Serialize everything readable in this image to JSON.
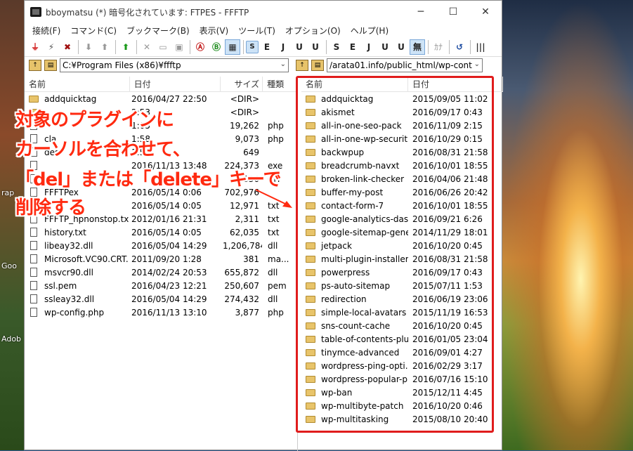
{
  "window": {
    "title": "bboymatsu (*) 暗号化されています: FTPES - FFFTP",
    "min": "─",
    "max": "☐",
    "close": "✕"
  },
  "menu": [
    "接続(F)",
    "コマンド(C)",
    "ブックマーク(B)",
    "表示(V)",
    "ツール(T)",
    "オプション(O)",
    "ヘルプ(H)"
  ],
  "toolbar": [
    "S",
    "E",
    "J",
    "U",
    "U",
    "S",
    "E",
    "J",
    "U",
    "U",
    "無",
    "ｶﾅ"
  ],
  "left_path": "C:¥Program Files (x86)¥ffftp",
  "right_path": "/arata01.info/public_html/wp-cont",
  "left_headers": {
    "name": "名前",
    "date": "日付",
    "size": "サイズ",
    "type": "種類"
  },
  "right_headers": {
    "name": "名前",
    "date": "日付"
  },
  "left_files": [
    {
      "name": "addquicktag",
      "date": "2016/04/27 22:50",
      "size": "<DIR>",
      "type": "",
      "folder": true
    },
    {
      "name": "",
      "date": "2:53",
      "size": "<DIR>",
      "type": "",
      "folder": true
    },
    {
      "name": "",
      "date": "1:05",
      "size": "19,262",
      "type": "php",
      "folder": false
    },
    {
      "name": "cla",
      "date": "1:58",
      "size": "9,073",
      "type": "php",
      "folder": false
    },
    {
      "name": "des",
      "date": "1:58",
      "size": "649",
      "type": "",
      "folder": false
    },
    {
      "name": "",
      "date": "2016/11/13 13:48",
      "size": "224,373",
      "type": "exe",
      "folder": false
    },
    {
      "name": "",
      "date": "",
      "size": "836",
      "type": "CH",
      "folder": false
    },
    {
      "name": "FFFTPex",
      "date": "2016/05/14 0:06",
      "size": "702,976",
      "type": "",
      "folder": false
    },
    {
      "name": "",
      "date": "2016/05/14 0:05",
      "size": "12,971",
      "type": "txt",
      "folder": false
    },
    {
      "name": "FFFTP_hpnonstop.txt",
      "date": "2012/01/16 21:31",
      "size": "2,311",
      "type": "txt",
      "folder": false
    },
    {
      "name": "history.txt",
      "date": "2016/05/14 0:05",
      "size": "62,035",
      "type": "txt",
      "folder": false
    },
    {
      "name": "libeay32.dll",
      "date": "2016/05/04 14:29",
      "size": "1,206,784",
      "type": "dll",
      "folder": false
    },
    {
      "name": "Microsoft.VC90.CRT.m...",
      "date": "2011/09/20 1:28",
      "size": "381",
      "type": "ma...",
      "folder": false
    },
    {
      "name": "msvcr90.dll",
      "date": "2014/02/24 20:53",
      "size": "655,872",
      "type": "dll",
      "folder": false
    },
    {
      "name": "ssl.pem",
      "date": "2016/04/23 12:21",
      "size": "250,607",
      "type": "pem",
      "folder": false
    },
    {
      "name": "ssleay32.dll",
      "date": "2016/05/04 14:29",
      "size": "274,432",
      "type": "dll",
      "folder": false
    },
    {
      "name": "wp-config.php",
      "date": "2016/11/13 13:10",
      "size": "3,877",
      "type": "php",
      "folder": false
    }
  ],
  "right_files": [
    {
      "name": "addquicktag",
      "date": "2015/09/05 11:02"
    },
    {
      "name": "akismet",
      "date": "2016/09/17 0:43"
    },
    {
      "name": "all-in-one-seo-pack",
      "date": "2016/11/09 2:15"
    },
    {
      "name": "all-in-one-wp-securit...",
      "date": "2016/10/29 0:15"
    },
    {
      "name": "backwpup",
      "date": "2016/08/31 21:58"
    },
    {
      "name": "breadcrumb-navxt",
      "date": "2016/10/01 18:55"
    },
    {
      "name": "broken-link-checker",
      "date": "2016/04/06 21:48"
    },
    {
      "name": "buffer-my-post",
      "date": "2016/06/26 20:42"
    },
    {
      "name": "contact-form-7",
      "date": "2016/10/01 18:55"
    },
    {
      "name": "google-analytics-das...",
      "date": "2016/09/21 6:26"
    },
    {
      "name": "google-sitemap-gene...",
      "date": "2014/11/29 18:01"
    },
    {
      "name": "jetpack",
      "date": "2016/10/20 0:45"
    },
    {
      "name": "multi-plugin-installer",
      "date": "2016/08/31 21:58"
    },
    {
      "name": "powerpress",
      "date": "2016/09/17 0:43"
    },
    {
      "name": "ps-auto-sitemap",
      "date": "2015/07/11 1:53"
    },
    {
      "name": "redirection",
      "date": "2016/06/19 23:06"
    },
    {
      "name": "simple-local-avatars",
      "date": "2015/11/19 16:53"
    },
    {
      "name": "sns-count-cache",
      "date": "2016/10/20 0:45"
    },
    {
      "name": "table-of-contents-plus",
      "date": "2016/01/05 23:04"
    },
    {
      "name": "tinymce-advanced",
      "date": "2016/09/01 4:27"
    },
    {
      "name": "wordpress-ping-opti...",
      "date": "2016/02/29 3:17"
    },
    {
      "name": "wordpress-popular-p...",
      "date": "2016/07/16 15:10"
    },
    {
      "name": "wp-ban",
      "date": "2015/12/11 4:45"
    },
    {
      "name": "wp-multibyte-patch",
      "date": "2016/10/20 0:46"
    },
    {
      "name": "wp-multitasking",
      "date": "2015/08/10 20:40"
    }
  ],
  "annotation": {
    "line1": "対象のプラグインに",
    "line2": "カーソルを合わせて、",
    "line3": "「del」または「delete」キーで",
    "line4": "削除する",
    "color": "#ff2a10"
  },
  "desktop": {
    "label1": "rap",
    "label2": "Goo",
    "label3": "Adob"
  }
}
